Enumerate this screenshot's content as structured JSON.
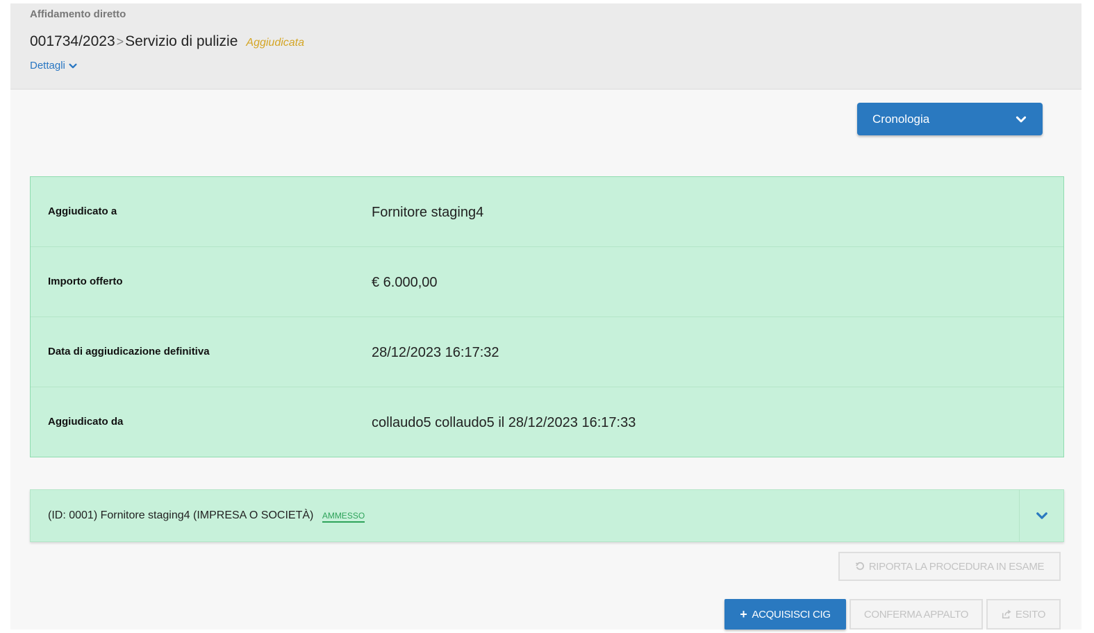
{
  "header": {
    "procedure_type": "Affidamento diretto",
    "procedure_number": "001734/2023",
    "separator": ">",
    "procedure_title": "Servizio di pulizie",
    "status": "Aggiudicata",
    "details_label": "Dettagli"
  },
  "history_dropdown": {
    "label": "Cronologia"
  },
  "award": {
    "rows": [
      {
        "label": "Aggiudicato a",
        "value": "Fornitore staging4"
      },
      {
        "label": "Importo offerto",
        "value": "€ 6.000,00"
      },
      {
        "label": "Data di aggiudicazione definitiva",
        "value": "28/12/2023 16:17:32"
      },
      {
        "label": "Aggiudicato da",
        "value": "collaudo5 collaudo5 il 28/12/2023 16:17:33"
      }
    ]
  },
  "bidder": {
    "text": "(ID: 0001) Fornitore staging4 (IMPRESA O SOCIETÀ)",
    "badge": "AMMESSO"
  },
  "actions": {
    "riporta_label": "RIPORTA LA PROCEDURA IN ESAME",
    "acquisisci_label": "ACQUISISCI CIG",
    "conferma_label": "CONFERMA APPALTO",
    "esito_label": "ESITO"
  },
  "colors": {
    "primary": "#2a79c0",
    "success_bg": "#c7f1da",
    "status_awarded": "#d4a524",
    "badge_admitted": "#2ea35a"
  }
}
